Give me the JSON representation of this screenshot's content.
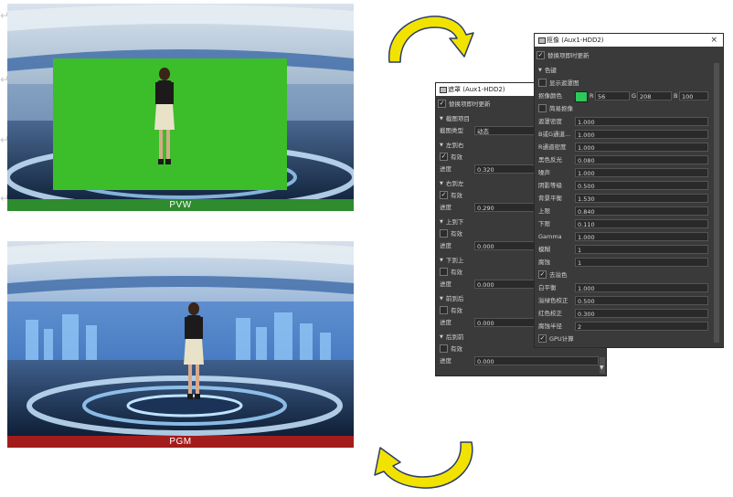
{
  "pvw": {
    "label": "PVW"
  },
  "pgm": {
    "label": "PGM"
  },
  "edge_icons": [
    "↵",
    "↵",
    "↵",
    "↵"
  ],
  "mask_panel": {
    "title": "遮罩 (Aux1-HDD2)",
    "realtime": "替换项即时更新",
    "section": "截图项目",
    "type_label": "截图类型",
    "type_value": "动态",
    "groups": [
      {
        "title": "左到右",
        "enabled": "有效",
        "checked": true,
        "value_label": "进度",
        "value": "0.320"
      },
      {
        "title": "右到左",
        "enabled": "有效",
        "checked": true,
        "value_label": "进度",
        "value": "0.290"
      },
      {
        "title": "上到下",
        "enabled": "有效",
        "checked": false,
        "value_label": "进度",
        "value": "0.000"
      },
      {
        "title": "下到上",
        "enabled": "有效",
        "checked": false,
        "value_label": "进度",
        "value": "0.000"
      },
      {
        "title": "前到后",
        "enabled": "有效",
        "checked": false,
        "value_label": "进度",
        "value": "0.000"
      },
      {
        "title": "后到前",
        "enabled": "有效",
        "checked": false,
        "value_label": "进度",
        "value": "0.000"
      }
    ]
  },
  "key_panel": {
    "title": "抠像 (Aux1-HDD2)",
    "close": "×",
    "realtime": "替换项即时更新",
    "section": "色键",
    "show_mask": "显示遮罩图",
    "key_color_label": "抠像颜色",
    "key_color": "#2ec85a",
    "r_label": "R",
    "r_value": "56",
    "g_label": "G",
    "g_value": "208",
    "b_label": "B",
    "b_value": "100",
    "simple_key": "简易抠像",
    "params": [
      {
        "label": "遮罩密度",
        "value": "1.000"
      },
      {
        "label": "B或G通道...",
        "value": "1.000"
      },
      {
        "label": "R通道密度",
        "value": "1.000"
      },
      {
        "label": "黑色反光",
        "value": "0.080"
      },
      {
        "label": "噪声",
        "value": "1.000"
      },
      {
        "label": "阴影等级",
        "value": "0.500"
      },
      {
        "label": "背景平衡",
        "value": "1.530"
      },
      {
        "label": "上限",
        "value": "0.840"
      },
      {
        "label": "下限",
        "value": "0.110"
      },
      {
        "label": "Gamma",
        "value": "1.000"
      },
      {
        "label": "模糊",
        "value": "1"
      },
      {
        "label": "腐蚀",
        "value": "1"
      }
    ],
    "despill": "去溢色",
    "params2": [
      {
        "label": "白平衡",
        "value": "1.000"
      },
      {
        "label": "溢绿色校正",
        "value": "0.500"
      },
      {
        "label": "红色校正",
        "value": "0.300"
      },
      {
        "label": "腐蚀半径",
        "value": "2"
      }
    ],
    "gpu": "GPU计算"
  }
}
